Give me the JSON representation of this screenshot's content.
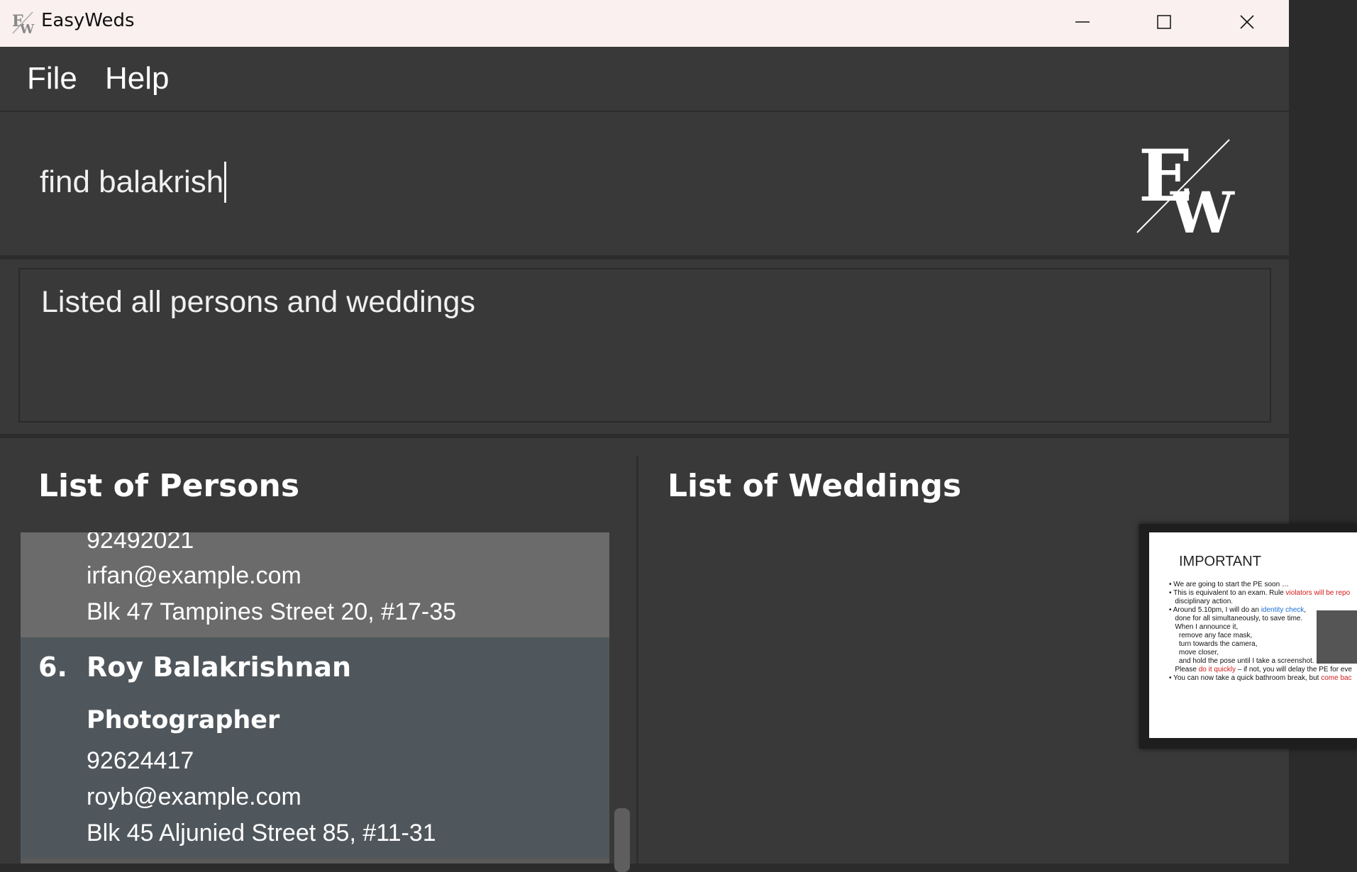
{
  "window": {
    "title": "EasyWeds"
  },
  "menu": {
    "file": "File",
    "help": "Help"
  },
  "command": {
    "value": "find balakrish"
  },
  "result": {
    "message": "Listed all persons and weddings"
  },
  "persons": {
    "heading": "List of Persons",
    "previous": {
      "phone": "92492021",
      "email": "irfan@example.com",
      "address": "Blk 47 Tampines Street 20, #17-35"
    },
    "selected": {
      "index": "6.",
      "name": "Roy Balakrishnan",
      "role": "Photographer",
      "phone": "92624417",
      "email": "royb@example.com",
      "address": "Blk 45 Aljunied Street 85, #11-31"
    }
  },
  "weddings": {
    "heading": "List of Weddings"
  },
  "overlay": {
    "slide_title": "IMPORTANT",
    "b1": "We are going to start the PE soon …",
    "b2a": "This is equivalent to an exam. Rule ",
    "b2b": "violators will be repo",
    "b2c": "disciplinary action.",
    "b3a": "Around 5.10pm, I will do an ",
    "b3b": "identity check",
    "b3c": "done for all simultaneously, to save time.",
    "b3d": "When I announce it,",
    "b3e": "remove any face mask,",
    "b3f": "turn towards the camera,",
    "b3g": "move closer,",
    "b3h": "and hold the pose until I take a screenshot.",
    "b3i": "Please ",
    "b3j": "do it quickly",
    "b3k": " – if not, you will delay the PE for eve",
    "b4a": "You can now take a quick bathroom break, but ",
    "b4b": "come bac"
  },
  "colors": {
    "selected_card": "#50575c",
    "previous_card": "#6b6b6b",
    "background": "#393939"
  }
}
